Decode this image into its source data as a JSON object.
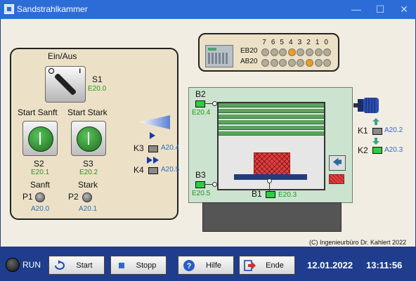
{
  "window": {
    "title": "Sandstrahlkammer",
    "controls": [
      "minimize-icon",
      "maximize-icon",
      "close-icon"
    ]
  },
  "left_panel": {
    "switch_title": "Ein/Aus",
    "s1": {
      "label": "S1",
      "address": "E20.0"
    },
    "start_soft_label": "Start Sanft",
    "start_strong_label": "Start Stark",
    "s2": {
      "label": "S2",
      "address": "E20.1"
    },
    "s3": {
      "label": "S3",
      "address": "E20.2"
    },
    "p1": {
      "caption": "Sanft",
      "label": "P1",
      "address": "A20.0"
    },
    "p2": {
      "caption": "Stark",
      "label": "P2",
      "address": "A20.1"
    }
  },
  "status_panel": {
    "bit_numbers": [
      "7",
      "6",
      "5",
      "4",
      "3",
      "2",
      "1",
      "0"
    ],
    "eb20": {
      "label": "EB20",
      "bits": [
        0,
        0,
        0,
        1,
        0,
        0,
        0,
        0
      ]
    },
    "ab20": {
      "label": "AB20",
      "bits": [
        0,
        0,
        0,
        0,
        0,
        1,
        0,
        0
      ]
    }
  },
  "chamber": {
    "b2": {
      "label": "B2",
      "address": "E20.4"
    },
    "b3": {
      "label": "B3",
      "address": "E20.5"
    },
    "b1": {
      "label": "B1",
      "address": "E20.3"
    },
    "k3": {
      "label": "K3",
      "address": "A20.4"
    },
    "k4": {
      "label": "K4",
      "address": "A20.5"
    },
    "k1": {
      "label": "K1",
      "address": "A20.2"
    },
    "k2": {
      "label": "K2",
      "address": "A20.3"
    }
  },
  "copyright": "(C) Ingenieurbüro Dr. Kahlert 2022",
  "bottom_bar": {
    "run_label": "RUN",
    "start_label": "Start",
    "stop_label": "Stopp",
    "help_label": "Hilfe",
    "end_label": "Ende",
    "date": "12.01.2022",
    "time": "13:11:56"
  },
  "colors": {
    "title_bar": "#2c6cd6",
    "bottom_bar": "#1f3d8c",
    "panel": "#ece1c7",
    "chamber": "#cce3cf",
    "address_green": "#1a9a1a",
    "address_blue": "#2b6cc4",
    "led_on": "#f39c1a"
  }
}
